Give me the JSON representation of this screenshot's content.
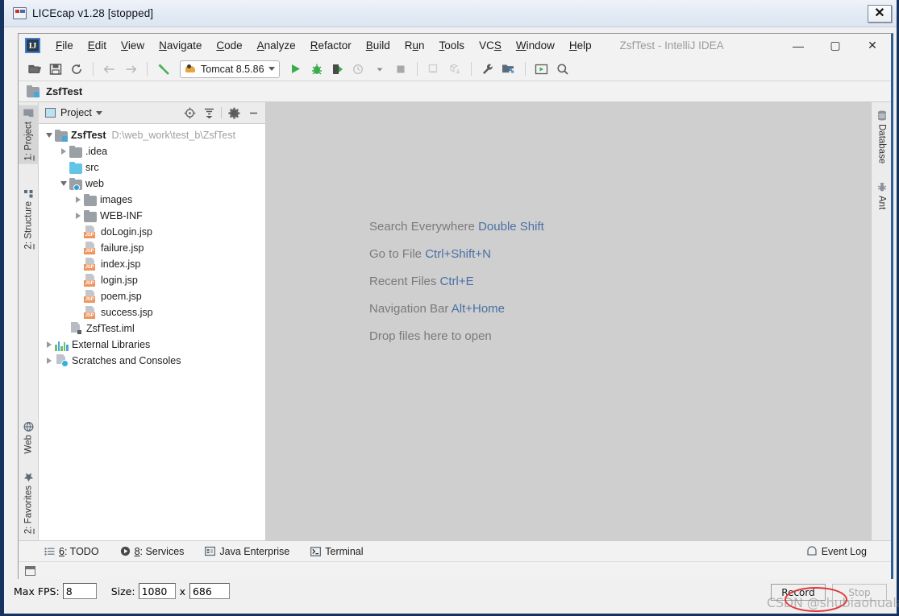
{
  "licecap": {
    "title": "LICEcap v1.28 [stopped]",
    "title_icon": "licecap-monitor-icon",
    "close_label": "✕",
    "fps_label": "Max FPS:",
    "fps_value": "8",
    "size_label": "Size:",
    "size_width": "1080",
    "size_x": "x",
    "size_height": "686",
    "record_label": "Record",
    "stop_label": "Stop",
    "watermark": "CSDN @shubiaohuala...",
    "annotation_color": "#e03a3a"
  },
  "idea": {
    "window_title": "ZsfTest - IntelliJ IDEA",
    "logo_text": "IJ",
    "menus": [
      {
        "pre": "",
        "mn": "F",
        "post": "ile"
      },
      {
        "pre": "",
        "mn": "E",
        "post": "dit"
      },
      {
        "pre": "",
        "mn": "V",
        "post": "iew"
      },
      {
        "pre": "",
        "mn": "N",
        "post": "avigate"
      },
      {
        "pre": "",
        "mn": "C",
        "post": "ode"
      },
      {
        "pre": "",
        "mn": "A",
        "post": "nalyze"
      },
      {
        "pre": "",
        "mn": "R",
        "post": "efactor"
      },
      {
        "pre": "",
        "mn": "B",
        "post": "uild"
      },
      {
        "pre": "R",
        "mn": "u",
        "post": "n"
      },
      {
        "pre": "",
        "mn": "T",
        "post": "ools"
      },
      {
        "pre": "VC",
        "mn": "S",
        "post": ""
      },
      {
        "pre": "",
        "mn": "W",
        "post": "indow"
      },
      {
        "pre": "",
        "mn": "H",
        "post": "elp"
      }
    ],
    "window_controls": [
      {
        "name": "minimize",
        "glyph": "—"
      },
      {
        "name": "maximize",
        "glyph": "▢"
      },
      {
        "name": "close",
        "glyph": "✕"
      }
    ],
    "toolbar": {
      "open_icon": "open-folder-icon",
      "save_icon": "save-icon",
      "sync_icon": "sync-icon",
      "back_icon": "arrow-left-icon",
      "forward_icon": "arrow-right-icon",
      "build_icon": "hammer-icon",
      "run_config": "Tomcat 8.5.86",
      "run_icon": "run-icon",
      "debug_icon": "debug-icon",
      "run_coverage_icon": "run-with-coverage-icon",
      "profile_icon": "profiler-icon",
      "stop_icon": "stop-icon",
      "update_app_icon": "update-running-application-icon",
      "deploy_icon": "deploy-icon",
      "settings_icon": "wrench-icon",
      "project-structure_icon": "project-structure-icon",
      "select_in_icon": "select-in-icon",
      "search_icon": "search-everywhere-icon"
    },
    "navbar": {
      "icon": "module-icon",
      "label": "ZsfTest"
    },
    "left_strip": [
      {
        "label_pre": "",
        "mn": "1",
        "label_post": ": Project",
        "icon": "project-icon",
        "selected": true
      },
      {
        "label_pre": "",
        "mn": "2",
        "label_post": ": Structure",
        "icon": "structure-icon",
        "selected": false
      },
      {
        "label_pre": "Web",
        "mn": "",
        "label_post": "",
        "icon": "web-icon",
        "selected": false
      },
      {
        "label_pre": "",
        "mn": "2",
        "label_post": ": Favorites",
        "icon": "favorites-star-icon",
        "selected": false
      }
    ],
    "right_strip": [
      {
        "label": "Database",
        "icon": "database-icon"
      },
      {
        "label": "Ant",
        "icon": "ant-icon"
      }
    ],
    "project_panel": {
      "title": "Project",
      "title_icon": "project-window-icon",
      "dropdown_icon": "chevron-down-icon",
      "actions": [
        {
          "name": "locate-icon"
        },
        {
          "name": "collapse-all-icon"
        },
        {
          "name": "gear-icon"
        },
        {
          "name": "hide-icon"
        }
      ],
      "tree": [
        {
          "indent": 0,
          "arrow": "expanded",
          "icon": "module",
          "label": "ZsfTest",
          "bold": true,
          "path": "D:\\web_work\\test_b\\ZsfTest"
        },
        {
          "indent": 1,
          "arrow": "collapsed",
          "icon": "folder",
          "label": ".idea",
          "bold": false,
          "path": ""
        },
        {
          "indent": 1,
          "arrow": "none",
          "icon": "folder-src",
          "label": "src",
          "bold": false,
          "path": ""
        },
        {
          "indent": 1,
          "arrow": "expanded",
          "icon": "webfolder",
          "label": "web",
          "bold": false,
          "path": ""
        },
        {
          "indent": 2,
          "arrow": "collapsed",
          "icon": "folder",
          "label": "images",
          "bold": false,
          "path": ""
        },
        {
          "indent": 2,
          "arrow": "collapsed",
          "icon": "folder",
          "label": "WEB-INF",
          "bold": false,
          "path": ""
        },
        {
          "indent": 2,
          "arrow": "none",
          "icon": "jsp",
          "label": "doLogin.jsp",
          "bold": false,
          "path": ""
        },
        {
          "indent": 2,
          "arrow": "none",
          "icon": "jsp",
          "label": "failure.jsp",
          "bold": false,
          "path": ""
        },
        {
          "indent": 2,
          "arrow": "none",
          "icon": "jsp",
          "label": "index.jsp",
          "bold": false,
          "path": ""
        },
        {
          "indent": 2,
          "arrow": "none",
          "icon": "jsp",
          "label": "login.jsp",
          "bold": false,
          "path": ""
        },
        {
          "indent": 2,
          "arrow": "none",
          "icon": "jsp",
          "label": "poem.jsp",
          "bold": false,
          "path": ""
        },
        {
          "indent": 2,
          "arrow": "none",
          "icon": "jsp",
          "label": "success.jsp",
          "bold": false,
          "path": ""
        },
        {
          "indent": 1,
          "arrow": "none",
          "icon": "iml",
          "label": "ZsfTest.iml",
          "bold": false,
          "path": ""
        },
        {
          "indent": 0,
          "arrow": "collapsed",
          "icon": "bars",
          "label": "External Libraries",
          "bold": false,
          "path": ""
        },
        {
          "indent": 0,
          "arrow": "collapsed",
          "icon": "scratch",
          "label": "Scratches and Consoles",
          "bold": false,
          "path": ""
        }
      ]
    },
    "editor_hints": [
      {
        "text": "Search Everywhere",
        "key": "Double Shift"
      },
      {
        "text": "Go to File",
        "key": "Ctrl+Shift+N"
      },
      {
        "text": "Recent Files",
        "key": "Ctrl+E"
      },
      {
        "text": "Navigation Bar",
        "key": "Alt+Home"
      },
      {
        "text": "Drop files here to open",
        "key": ""
      }
    ],
    "status_bar": {
      "items": [
        {
          "pre": "",
          "mn": "6",
          "post": ": TODO",
          "icon": "todo-icon"
        },
        {
          "pre": "",
          "mn": "8",
          "post": ": Services",
          "icon": "services-icon"
        },
        {
          "pre": "Java Enterprise",
          "mn": "",
          "post": "",
          "icon": "java-enterprise-icon"
        },
        {
          "pre": "Terminal",
          "mn": "",
          "post": "",
          "icon": "terminal-icon"
        }
      ],
      "event_log": "Event Log",
      "event_log_icon": "event-log-icon"
    }
  }
}
